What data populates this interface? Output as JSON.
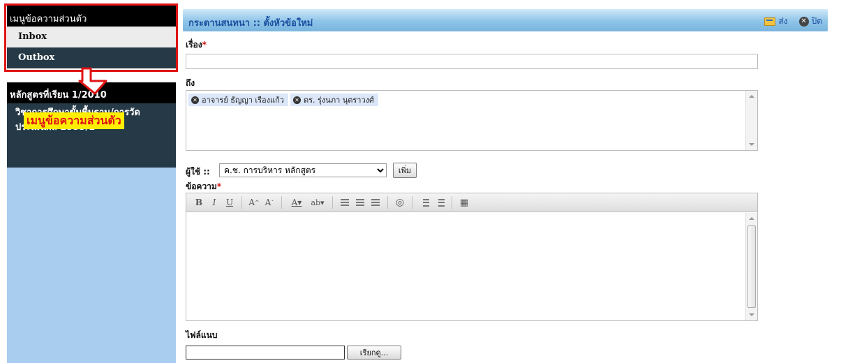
{
  "sidebar": {
    "message_menu_title": "เมนูข้อความส่วนตัว",
    "items": [
      {
        "label": "Inbox"
      },
      {
        "label": "Outbox"
      }
    ],
    "course_header": "หลักสูตรที่เรียน 1/2010",
    "course_item": "วิชาการศึกษาขั้นพื้นฐาน/การวัดประเมินผล 2553/1"
  },
  "callout": {
    "label": "เมนูข้อความส่วนตัว"
  },
  "main": {
    "title": "กระดานสนทนา :: ตั้งหัวข้อใหม่",
    "send_label": "ส่ง",
    "close_label": "ปิด",
    "subject_label": "เรื่อง",
    "subject_value": "",
    "required_mark": "*",
    "to_label": "ถึง",
    "recipients": [
      "อาจารย์ ธัญญา เรืองแก้ว",
      "ดร. รุ่งนภา นุตราวงศ์"
    ],
    "user_label": "ผู้ใช้ ::",
    "user_selected": "ค.ช. การบริหาร หลักสูตร",
    "add_button": "เพิ่ม",
    "message_label": "ข้อความ",
    "attachment_label": "ไฟล์แนบ",
    "browse_button": "เรียกดู..."
  },
  "colors": {
    "sidebar_bg": "#a9cdef",
    "sidebar_dark": "#253946",
    "header_black": "#000000",
    "title_blue": "#1a4f9f",
    "highlight_red": "#e01414",
    "callout_yellow": "#ffee00"
  },
  "icons": {
    "send": "send-mail-icon",
    "close": "close-circle-icon",
    "chip_remove": "remove-recipient-icon"
  }
}
